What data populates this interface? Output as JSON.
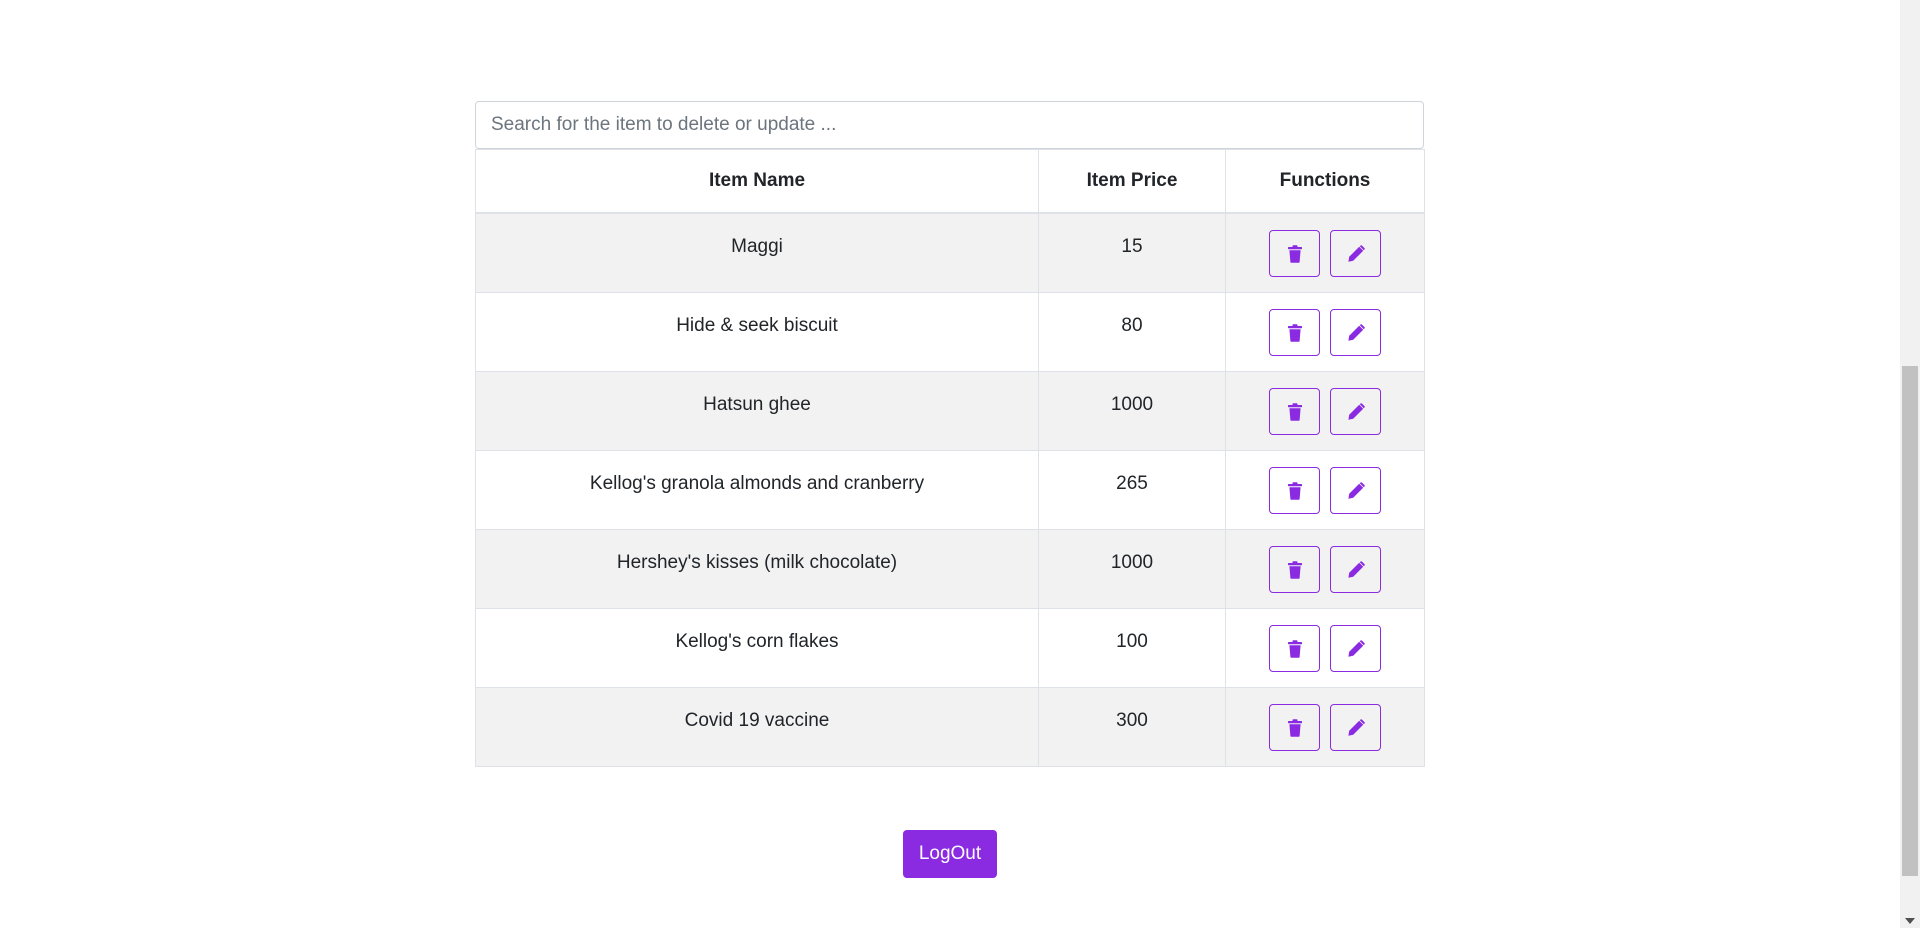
{
  "search": {
    "placeholder": "Search for the item to delete or update ...",
    "value": ""
  },
  "table": {
    "headers": [
      "Item Name",
      "Item Price",
      "Functions"
    ],
    "rows": [
      {
        "name": "Maggi",
        "price": "15"
      },
      {
        "name": "Hide & seek biscuit",
        "price": "80"
      },
      {
        "name": "Hatsun ghee",
        "price": "1000"
      },
      {
        "name": "Kellog's granola almonds and cranberry",
        "price": "265"
      },
      {
        "name": "Hershey's kisses (milk chocolate)",
        "price": "1000"
      },
      {
        "name": "Kellog's corn flakes",
        "price": "100"
      },
      {
        "name": "Covid 19 vaccine",
        "price": "300"
      }
    ],
    "row_actions": {
      "delete_icon": "trash-icon",
      "edit_icon": "pencil-icon"
    }
  },
  "logout": {
    "label": "LogOut"
  },
  "colors": {
    "accent": "#8a2be2",
    "striped_row": "#f2f2f2",
    "border": "#dee2e6"
  }
}
